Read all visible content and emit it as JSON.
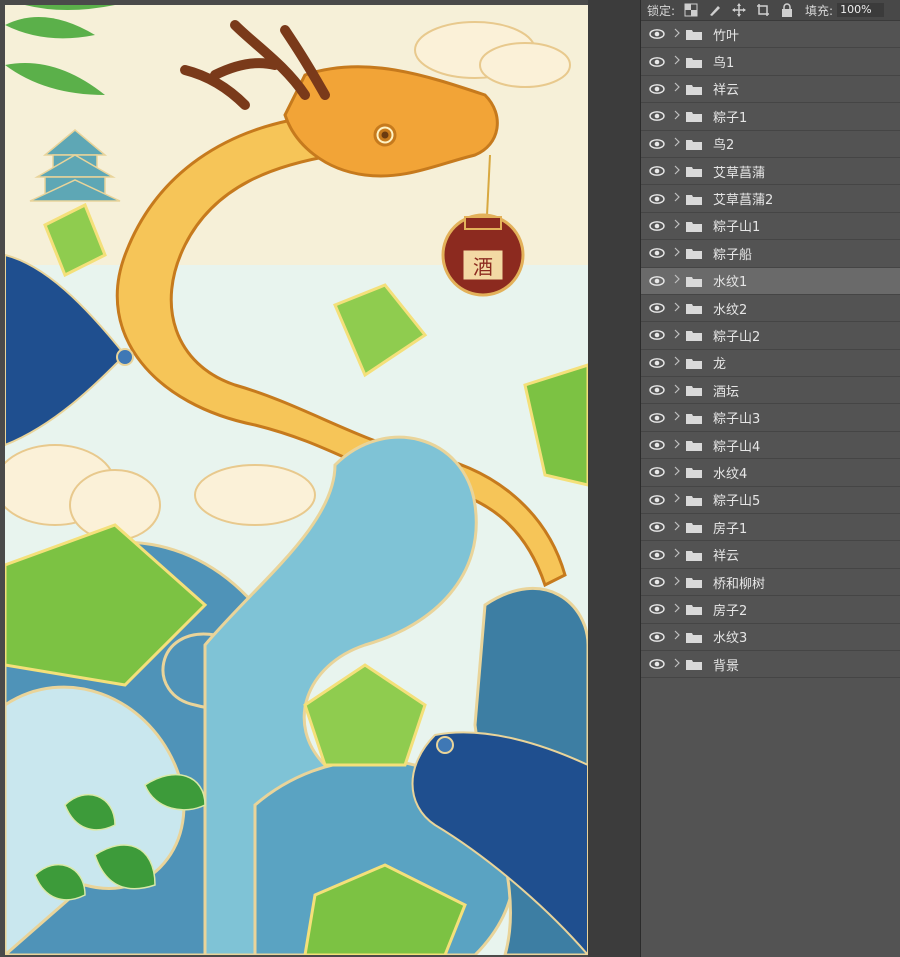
{
  "toolbar": {
    "lock_label": "锁定:",
    "fill_label": "填充:",
    "fill_value": "100%"
  },
  "layers": [
    {
      "name": "竹叶",
      "selected": false
    },
    {
      "name": "鸟1",
      "selected": false
    },
    {
      "name": "祥云",
      "selected": false
    },
    {
      "name": "粽子1",
      "selected": false
    },
    {
      "name": "鸟2",
      "selected": false
    },
    {
      "name": "艾草菖蒲",
      "selected": false
    },
    {
      "name": "艾草菖蒲2",
      "selected": false
    },
    {
      "name": "粽子山1",
      "selected": false
    },
    {
      "name": "粽子船",
      "selected": false
    },
    {
      "name": "水纹1",
      "selected": true
    },
    {
      "name": "水纹2",
      "selected": false
    },
    {
      "name": "粽子山2",
      "selected": false
    },
    {
      "name": "龙",
      "selected": false
    },
    {
      "name": "酒坛",
      "selected": false
    },
    {
      "name": "粽子山3",
      "selected": false
    },
    {
      "name": "粽子山4",
      "selected": false
    },
    {
      "name": "水纹4",
      "selected": false
    },
    {
      "name": "粽子山5",
      "selected": false
    },
    {
      "name": "房子1",
      "selected": false
    },
    {
      "name": "祥云",
      "selected": false
    },
    {
      "name": "桥和柳树",
      "selected": false
    },
    {
      "name": "房子2",
      "selected": false
    },
    {
      "name": "水纹3",
      "selected": false
    },
    {
      "name": "背景",
      "selected": false
    }
  ],
  "artwork": {
    "wine_jar_text": "酒"
  },
  "icons": {
    "eye": "eye-icon",
    "folder": "folder-icon",
    "chevron": "chevron-right-icon"
  },
  "colors": {
    "panel_bg": "#535353",
    "selected_row": "#6a6a6a",
    "dragon": "#f2a437",
    "water_blue": "#4f93b8",
    "leaf_green": "#7cc243"
  }
}
